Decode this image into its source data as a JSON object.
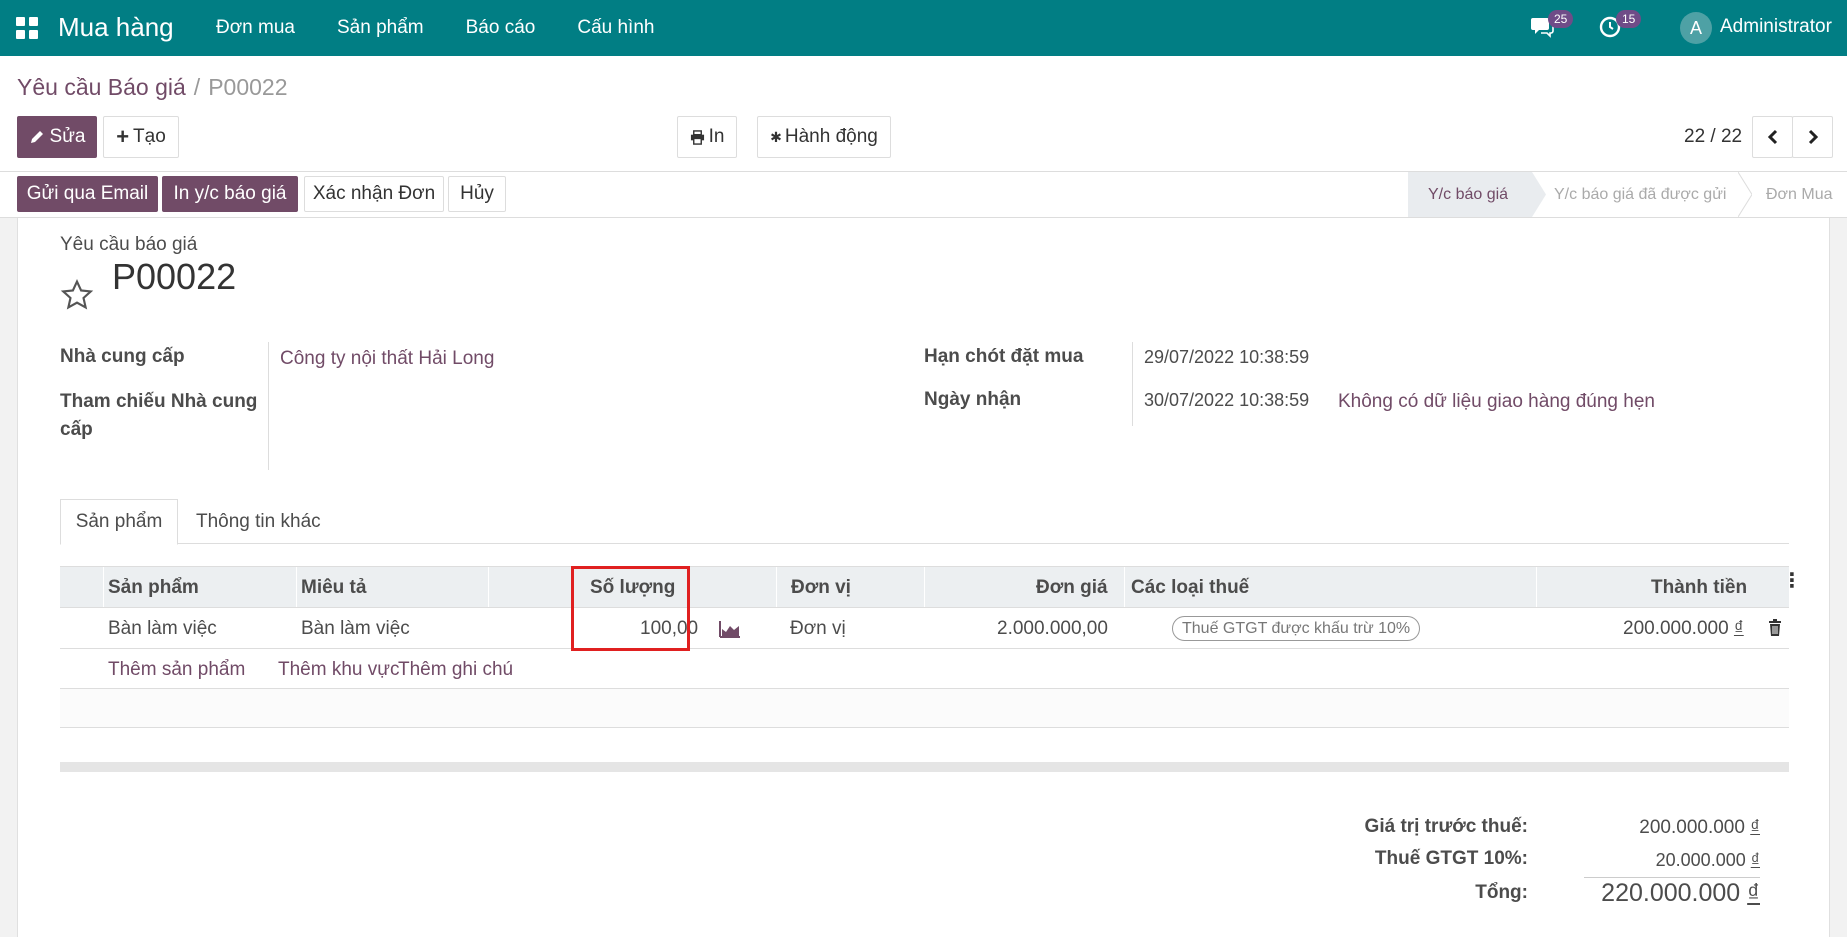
{
  "navbar": {
    "brand": "Mua hàng",
    "menu": [
      "Đơn mua",
      "Sản phẩm",
      "Báo cáo",
      "Cấu hình"
    ],
    "messages_count": "25",
    "activities_count": "15",
    "avatar_letter": "A",
    "user": "Administrator"
  },
  "breadcrumb": {
    "parent": "Yêu cầu Báo giá",
    "separator": "/",
    "current": "P00022"
  },
  "toolbar": {
    "edit": "Sửa",
    "create": "Tạo",
    "print": "In",
    "action": "Hành động"
  },
  "pager": {
    "value": "22 / 22"
  },
  "statusbar": {
    "buttons": [
      "Gửi qua Email",
      "In y/c báo giá",
      "Xác nhận Đơn",
      "Hủy"
    ],
    "stages": [
      "Y/c báo giá",
      "Y/c báo giá đã được gửi",
      "Đơn Mua"
    ],
    "active_stage": "Y/c báo giá"
  },
  "form": {
    "subtitle": "Yêu cầu báo giá",
    "name": "P00022",
    "vendor_label": "Nhà cung cấp",
    "vendor": "Công ty nội thất Hải Long",
    "vendor_ref_label": "Tham chiếu Nhà cung cấp",
    "deadline_label": "Hạn chót đặt mua",
    "deadline": "29/07/2022 10:38:59",
    "receipt_label": "Ngày nhận",
    "receipt": "30/07/2022 10:38:59",
    "on_time_note": "Không có dữ liệu giao hàng đúng hẹn"
  },
  "tabs": [
    "Sản phẩm",
    "Thông tin khác"
  ],
  "table": {
    "headers": [
      "Sản phẩm",
      "Miêu tả",
      "Số lượng",
      "Đơn vị",
      "Đơn giá",
      "Các loại thuế",
      "Thành tiền"
    ],
    "rows": [
      {
        "product": "Bàn làm việc",
        "description": "Bàn làm việc",
        "quantity": "100,00",
        "uom": "Đơn vị",
        "price": "2.000.000,00",
        "tax": "Thuế GTGT được khấu trừ 10%",
        "subtotal": "200.000.000",
        "currency": "₫"
      }
    ],
    "add_product": "Thêm sản phẩm",
    "add_section": "Thêm khu vực",
    "add_note": "Thêm ghi chú"
  },
  "totals": {
    "untaxed_label": "Giá trị trước thuế:",
    "untaxed": "200.000.000",
    "tax_label": "Thuế GTGT 10%:",
    "tax": "20.000.000",
    "total_label": "Tổng:",
    "total": "220.000.000",
    "currency": "₫"
  },
  "colors": {
    "navbar": "#017e84",
    "primary": "#714b67",
    "highlight": "#e02020"
  }
}
